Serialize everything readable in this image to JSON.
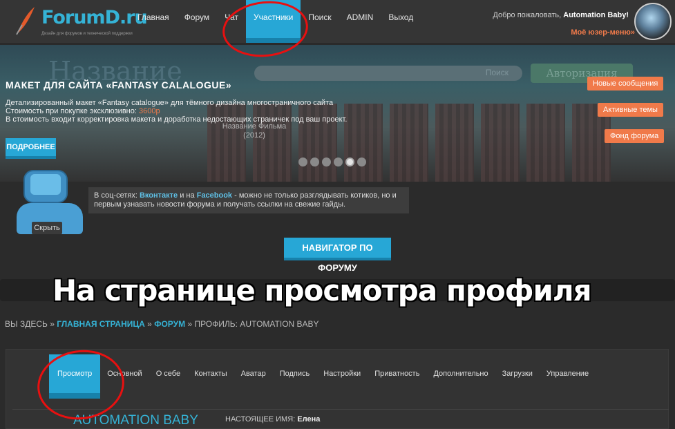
{
  "logo": {
    "name": "ForumD.ru",
    "tagline": "Дизайн для форумов и технической поддержки"
  },
  "nav": [
    "Главная",
    "Форум",
    "Чат",
    "Участники",
    "Поиск",
    "ADMIN",
    "Выход"
  ],
  "nav_active": "Участники",
  "welcome": {
    "prefix": "Добро пожаловать,",
    "user": "Automation Baby!"
  },
  "usermenu": "Моё юзер-меню»",
  "banner": {
    "ghost_title": "Название",
    "search_label": "Поиск",
    "auth_label": "Авторизация",
    "title": "МАКЕТ ДЛЯ САЙТА «FANTASY CALALOGUE»",
    "line1": "Детализированный макет «Fantasy catalogue» для тёмного дизайна многостраничного сайта",
    "line2_prefix": "Стоимость при покупке эксклюзивно:",
    "price": "3600р",
    "line3": "В стоимость входит корректировка макета и доработка недостающих страничек под ваш проект.",
    "more": "ПОДРОБНЕЕ",
    "poster_caption": "Название Фильма (2012)"
  },
  "side_buttons": [
    "Новые сообщения",
    "Активные темы",
    "Фонд форума"
  ],
  "robot_hide": "Скрыть",
  "social": {
    "prefix": "В соц-сетях:",
    "vk": "Вконтакте",
    "and": "и на",
    "fb": "Facebook",
    "text": "- можно не только разглядывать котиков, но и первым узнавать новости форума и получать ссылки на свежие гайды."
  },
  "forum_nav": "НАВИГАТОР ПО ФОРУМУ",
  "caption": "На странице просмотра профиля",
  "breadcrumb": {
    "prefix": "Вы здесь »",
    "home": "Главная страница",
    "forum": "Форум",
    "current": "» Профиль: Automation Baby"
  },
  "profile_tabs": [
    "Просмотр",
    "Основной",
    "О себе",
    "Контакты",
    "Аватар",
    "Подпись",
    "Настройки",
    "Приватность",
    "Дополнительно",
    "Загрузки",
    "Управление"
  ],
  "profile_tab_active": "Просмотр",
  "profile": {
    "name": "Automation Baby",
    "real_name_label": "Настоящее имя:",
    "real_name": "Елена"
  },
  "colors": {
    "accent": "#27a7d6",
    "orange": "#f07a4a",
    "annotation": "#e81010"
  }
}
